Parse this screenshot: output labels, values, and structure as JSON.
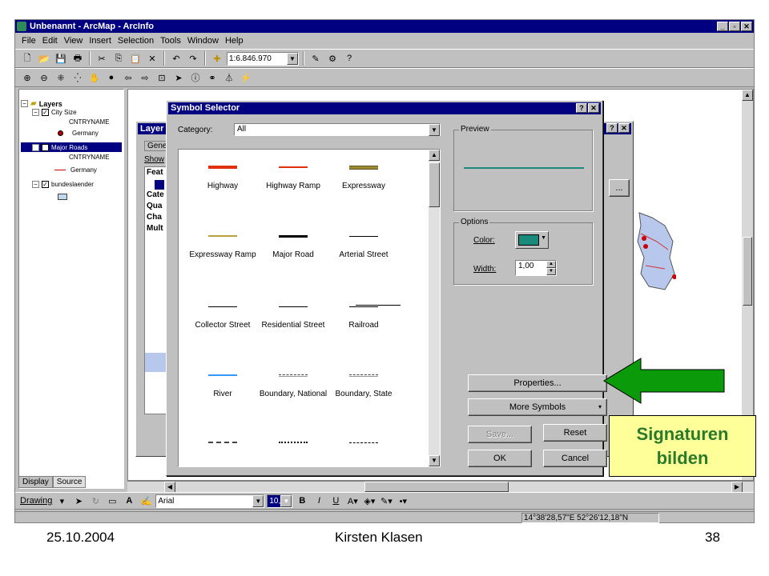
{
  "window": {
    "title": "Unbenannt - ArcMap - ArcInfo",
    "minimize": "_",
    "maximize": "▫",
    "close": "✕"
  },
  "menu": [
    "File",
    "Edit",
    "View",
    "Insert",
    "Selection",
    "Tools",
    "Window",
    "Help"
  ],
  "toolbar": {
    "scale": "1:6.846.970"
  },
  "toc": {
    "layers_label": "Layers",
    "items": [
      {
        "label": "City Size"
      },
      {
        "label": "CNTRYNAME"
      },
      {
        "label": "Germany"
      },
      {
        "label": "Major Roads"
      },
      {
        "label": "CNTRYNAME"
      },
      {
        "label": "Germany"
      },
      {
        "label": "bundeslaender"
      }
    ],
    "tabs": [
      "Display",
      "Source"
    ]
  },
  "layer_dialog": {
    "title": "Layer",
    "tab": "Gene",
    "show": "Show",
    "list": [
      "Feat",
      "Cate",
      "Qua",
      "Cha",
      "Mult"
    ]
  },
  "symbol_selector": {
    "title": "Symbol Selector",
    "category_label": "Category:",
    "category_value": "All",
    "preview_label": "Preview",
    "options_label": "Options",
    "color_label": "Color:",
    "width_label": "Width:",
    "width_value": "1,00",
    "symbols": [
      {
        "label": "Highway",
        "color": "#e03010"
      },
      {
        "label": "Highway Ramp",
        "color": "#e03010"
      },
      {
        "label": "Expressway",
        "color": "#9c8c30"
      },
      {
        "label": "Expressway Ramp",
        "color": "#b8a040"
      },
      {
        "label": "Major Road",
        "color": "#000000"
      },
      {
        "label": "Arterial Street",
        "color": "#000000"
      },
      {
        "label": "Collector Street",
        "color": "#000000"
      },
      {
        "label": "Residential Street",
        "color": "#000000"
      },
      {
        "label": "Railroad",
        "color": "#000000"
      },
      {
        "label": "River",
        "color": "#3399ff"
      },
      {
        "label": "Boundary, National",
        "color": "#666666"
      },
      {
        "label": "Boundary, State",
        "color": "#666666"
      }
    ],
    "buttons": {
      "properties": "Properties...",
      "more_symbols": "More Symbols",
      "save": "Save...",
      "reset": "Reset",
      "ok": "OK",
      "cancel": "Cancel"
    },
    "preview_color": "#1a8a7a",
    "color_value": "#1a8a7a"
  },
  "drawing_toolbar": {
    "drawing_label": "Drawing",
    "font": "Arial",
    "size": "10,0"
  },
  "status": {
    "coords": "14°38'28,57\"E  52°26'12,18\"N"
  },
  "callout": {
    "line1": "Signaturen",
    "line2": "bilden",
    "arrow_color": "#0a9a0a"
  },
  "footer": {
    "date": "25.10.2004",
    "author": "Kirsten Klasen",
    "page": "38"
  }
}
